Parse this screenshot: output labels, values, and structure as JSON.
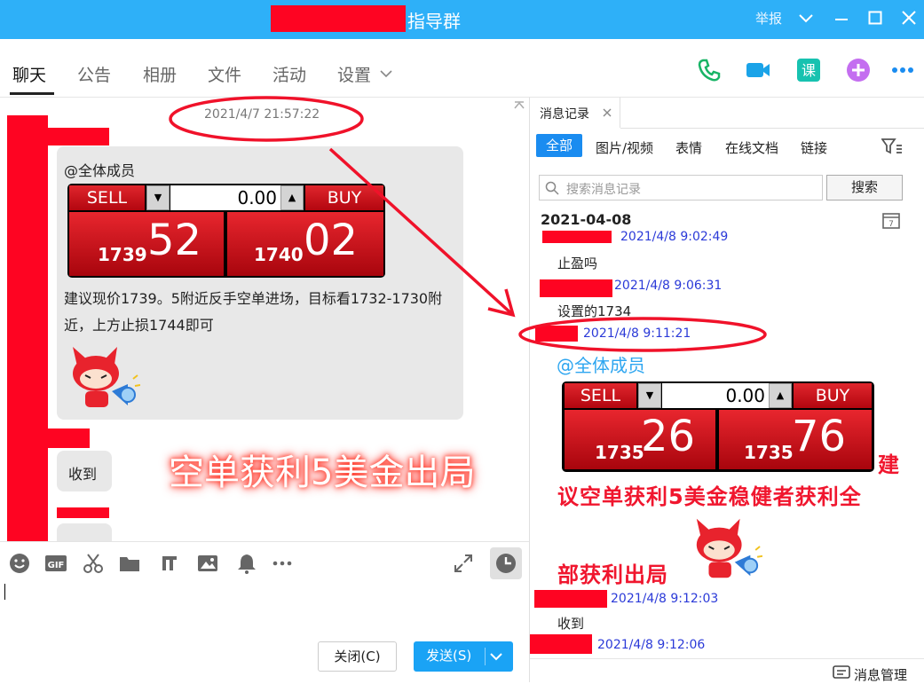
{
  "window": {
    "title": "指导群",
    "actions": {
      "report": "举报"
    }
  },
  "tabs": [
    {
      "label": "聊天"
    },
    {
      "label": "公告"
    },
    {
      "label": "相册"
    },
    {
      "label": "文件"
    },
    {
      "label": "活动"
    },
    {
      "label": "设置"
    }
  ],
  "chat": {
    "timestamp": "2021/4/7 21:57:22",
    "message1": {
      "mention": "@全体成员",
      "body_line1": "建议现价1739。5附近反手空单进场，目标看1732-1730附",
      "body_line2": "近，上方止损1744即可"
    },
    "trade_panel1": {
      "sell_label": "SELL",
      "buy_label": "BUY",
      "amount": "0.00",
      "sell_small": "1739",
      "sell_big": "52",
      "buy_small": "1740",
      "buy_big": "02"
    },
    "reply1": "收到",
    "overlay_caption": "空单获利5美金出局"
  },
  "input": {
    "close_label": "关闭(C)",
    "send_label": "发送(S)"
  },
  "history": {
    "tab_label": "消息记录",
    "filters": [
      "全部",
      "图片/视频",
      "表情",
      "在线文档",
      "链接"
    ],
    "search_placeholder": "搜索消息记录",
    "search_button": "搜索",
    "date": "2021-04-08",
    "entries": [
      {
        "time": "2021/4/8 9:02:49",
        "text": "止盈吗"
      },
      {
        "time": "2021/4/8 9:06:31",
        "text": "设置的1734"
      },
      {
        "time": "2021/4/8 9:11:21",
        "text": "@全体成员"
      },
      {
        "time": "2021/4/8 9:12:03",
        "text": "收到"
      },
      {
        "time": "2021/4/8 9:12:06",
        "text": ""
      }
    ],
    "trade_panel2": {
      "sell_label": "SELL",
      "buy_label": "BUY",
      "amount": "0.00",
      "sell_small": "1735",
      "sell_big": "26",
      "buy_small": "1735",
      "buy_big": "76"
    },
    "note_line1": "建",
    "note_line2": "议空单获利5美金稳健者获利全",
    "note_line3": "部获利出局",
    "manage_label": "消息管理"
  }
}
